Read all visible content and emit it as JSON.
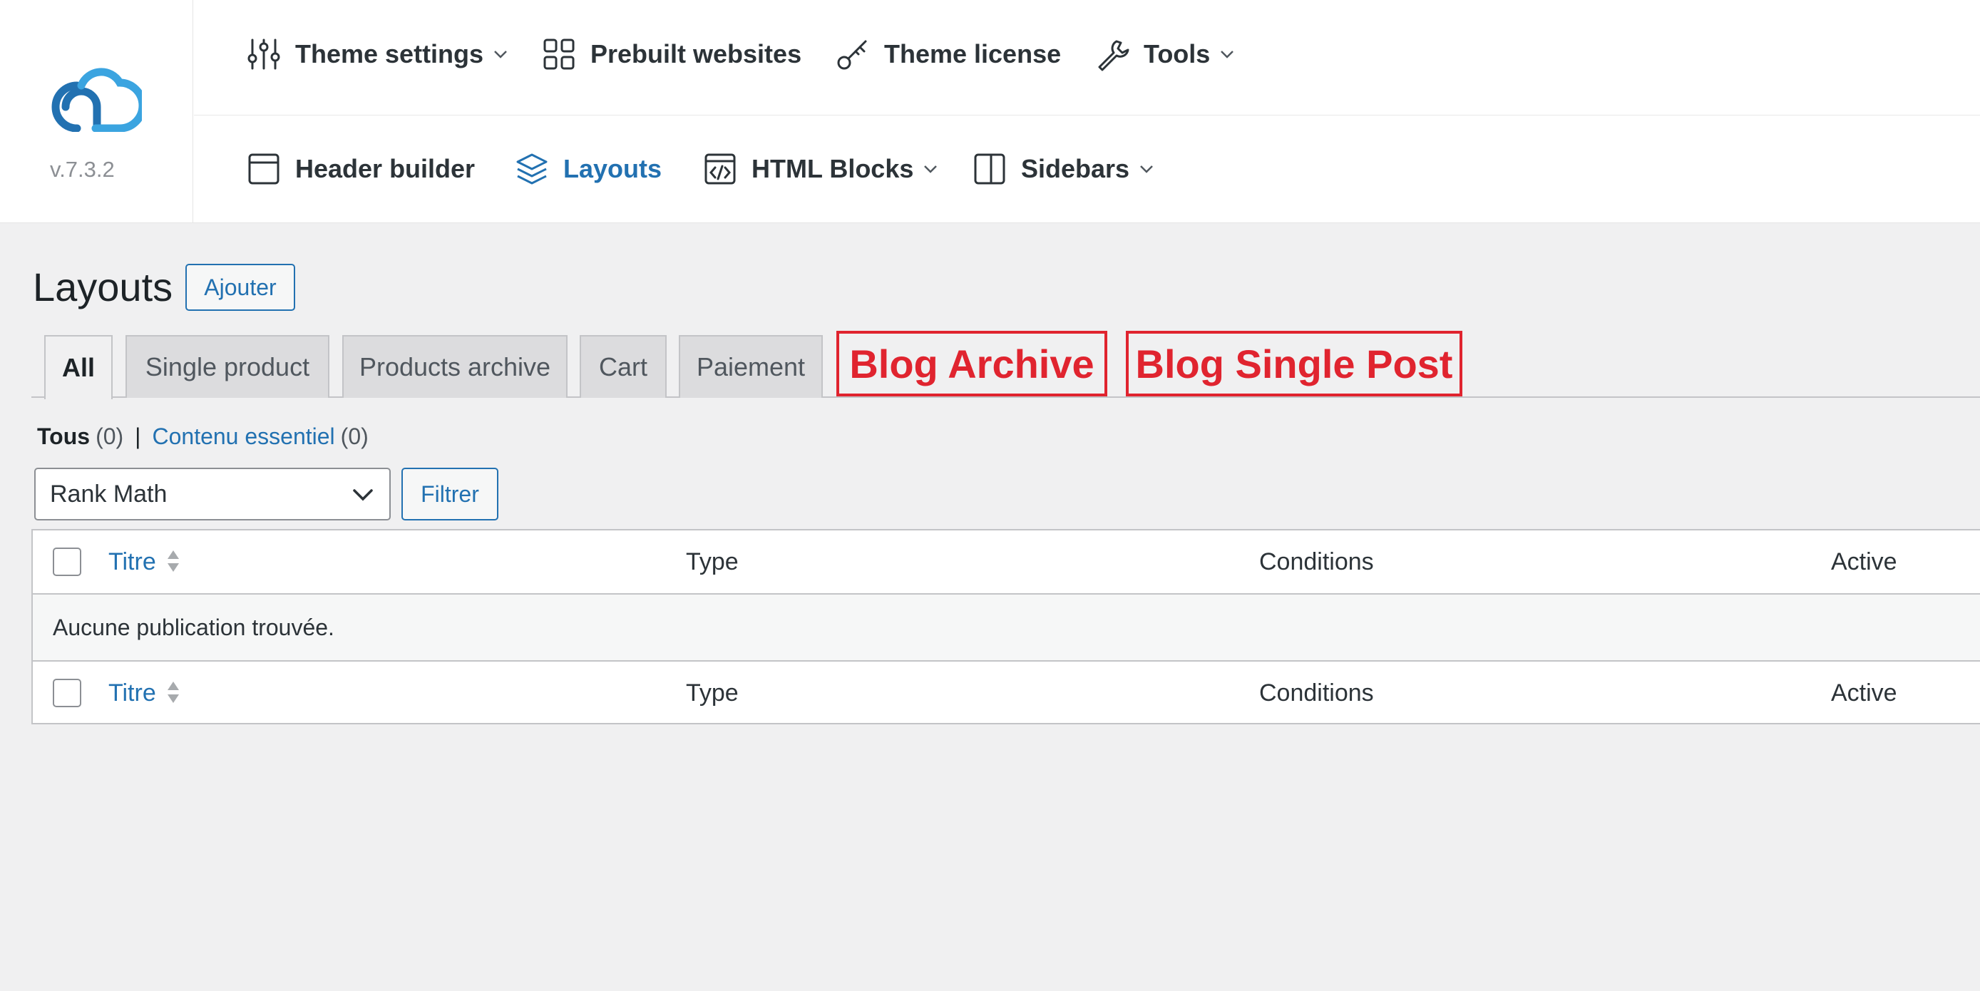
{
  "brand": {
    "version": "v.7.3.2",
    "accent_color": "#2271b1",
    "logo_icon": "cloud-logo-icon"
  },
  "top_nav": [
    {
      "label": "Theme settings",
      "icon": "sliders-icon",
      "has_dropdown": true
    },
    {
      "label": "Prebuilt websites",
      "icon": "grid-icon",
      "has_dropdown": false
    },
    {
      "label": "Theme license",
      "icon": "key-icon",
      "has_dropdown": false
    },
    {
      "label": "Tools",
      "icon": "wrench-icon",
      "has_dropdown": true
    }
  ],
  "sub_nav": [
    {
      "label": "Header builder",
      "icon": "layout-icon",
      "has_dropdown": false,
      "active": false
    },
    {
      "label": "Layouts",
      "icon": "layers-icon",
      "has_dropdown": false,
      "active": true
    },
    {
      "label": "HTML Blocks",
      "icon": "code-icon",
      "has_dropdown": true,
      "active": false
    },
    {
      "label": "Sidebars",
      "icon": "sidebar-icon",
      "has_dropdown": true,
      "active": false
    }
  ],
  "page": {
    "title": "Layouts",
    "add_button": "Ajouter"
  },
  "tabs": [
    {
      "label": "All",
      "active": true
    },
    {
      "label": "Single product",
      "active": false
    },
    {
      "label": "Products archive",
      "active": false
    },
    {
      "label": "Cart",
      "active": false
    },
    {
      "label": "Paiement",
      "active": false
    }
  ],
  "highlighted_tabs": [
    {
      "label": "Blog Archive",
      "color": "#e0242f"
    },
    {
      "label": "Blog Single Post",
      "color": "#e0242f"
    }
  ],
  "views": {
    "all_label": "Tous",
    "all_count": "(0)",
    "separator": "|",
    "essential_label": "Contenu essentiel",
    "essential_count": "(0)"
  },
  "filter": {
    "selected": "Rank Math",
    "button": "Filtrer"
  },
  "table": {
    "columns": [
      "Titre",
      "Type",
      "Conditions",
      "Active"
    ],
    "empty_message": "Aucune publication trouvée."
  }
}
